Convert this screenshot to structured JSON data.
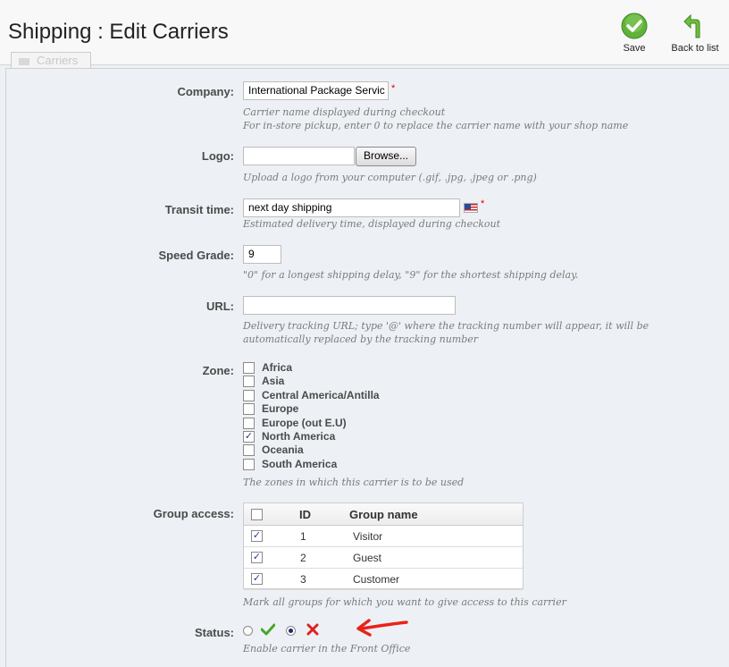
{
  "header": {
    "title": "Shipping : Edit Carriers",
    "save_label": "Save",
    "back_label": "Back to list",
    "tab_label": "Carriers"
  },
  "company": {
    "label": "Company:",
    "value": "International Package Servic",
    "required": "*",
    "hint1": "Carrier name displayed during checkout",
    "hint2": "For in-store pickup, enter 0 to replace the carrier name with your shop name"
  },
  "logo": {
    "label": "Logo:",
    "value": "",
    "browse_label": "Browse...",
    "hint": "Upload a logo from your computer (.gif, .jpg, .jpeg or .png)"
  },
  "transit": {
    "label": "Transit time:",
    "value": "next day shipping",
    "required": "*",
    "hint": "Estimated delivery time, displayed during checkout",
    "flag_icon": "us-flag-icon"
  },
  "speed": {
    "label": "Speed Grade:",
    "value": "9",
    "hint": "\"0\" for a longest shipping delay, \"9\" for the shortest shipping delay."
  },
  "url": {
    "label": "URL:",
    "value": "",
    "hint1": "Delivery tracking URL; type '@' where the tracking number will appear, it will be",
    "hint2": "automatically replaced by the tracking number"
  },
  "zone": {
    "label": "Zone:",
    "hint": "The zones in which this carrier is to be used",
    "items": [
      {
        "name": "Africa",
        "checked": false
      },
      {
        "name": "Asia",
        "checked": false
      },
      {
        "name": "Central America/Antilla",
        "checked": false
      },
      {
        "name": "Europe",
        "checked": false
      },
      {
        "name": "Europe (out E.U)",
        "checked": false
      },
      {
        "name": "North America",
        "checked": true
      },
      {
        "name": "Oceania",
        "checked": false
      },
      {
        "name": "South America",
        "checked": false
      }
    ]
  },
  "group": {
    "label": "Group access:",
    "hint": "Mark all groups for which you want to give access to this carrier",
    "columns": {
      "id": "ID",
      "name": "Group name"
    },
    "rows": [
      {
        "id": "1",
        "name": "Visitor",
        "checked": true
      },
      {
        "id": "2",
        "name": "Guest",
        "checked": true
      },
      {
        "id": "3",
        "name": "Customer",
        "checked": true
      }
    ]
  },
  "status": {
    "label": "Status:",
    "hint": "Enable carrier in the Front Office",
    "selected": "disabled"
  },
  "colors": {
    "accent_green": "#5fb33a",
    "error_red": "#e02020",
    "annotation_red": "#e8231a"
  }
}
